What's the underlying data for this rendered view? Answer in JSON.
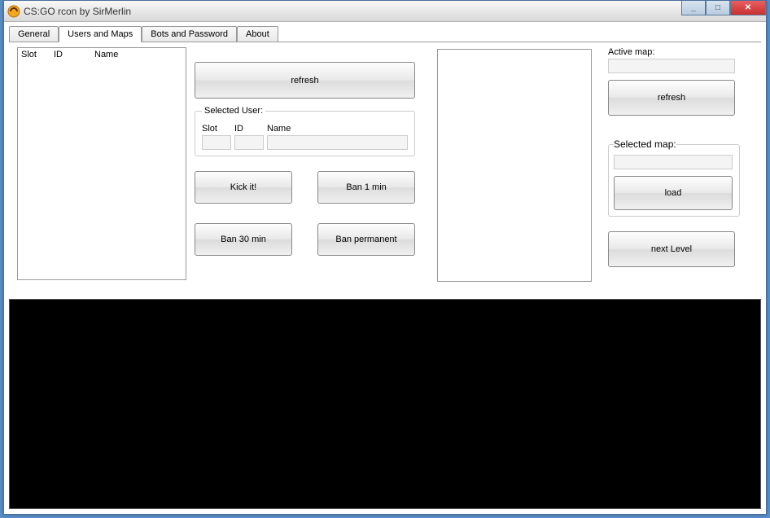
{
  "window": {
    "title": "CS:GO rcon by SirMerlin"
  },
  "tabs": {
    "general": "General",
    "users_maps": "Users and Maps",
    "bots_password": "Bots and Password",
    "about": "About"
  },
  "user_list": {
    "columns": {
      "slot": "Slot",
      "id": "ID",
      "name": "Name"
    },
    "rows": []
  },
  "buttons": {
    "refresh_users": "refresh",
    "kick": "Kick it!",
    "ban1": "Ban 1 min",
    "ban30": "Ban 30 min",
    "banperm": "Ban permanent",
    "refresh_maps": "refresh",
    "load": "load",
    "next_level": "next Level"
  },
  "selected_user": {
    "legend": "Selected User:",
    "labels": {
      "slot": "Slot",
      "id": "ID",
      "name": "Name"
    },
    "slot": "",
    "id": "",
    "name": ""
  },
  "maps": {
    "active_label": "Active map:",
    "active_value": "",
    "list": []
  },
  "selected_map": {
    "legend": "Selected map:",
    "value": ""
  },
  "win_controls": {
    "minimize": "_",
    "maximize": "□",
    "close": "✕"
  }
}
